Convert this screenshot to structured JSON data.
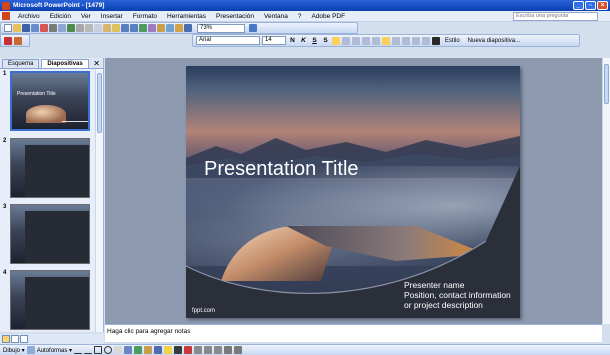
{
  "window": {
    "title": "Microsoft PowerPoint - [1479]"
  },
  "menu": {
    "items": [
      "Archivo",
      "Edición",
      "Ver",
      "Insertar",
      "Formato",
      "Herramientas",
      "Presentación",
      "Ventana",
      "?",
      "Adobe PDF"
    ],
    "help_placeholder": "Escriba una pregunta"
  },
  "toolbar": {
    "zoom": "73%",
    "font": "Arial",
    "font_size": "14",
    "design_label": "Estilo",
    "new_slide_label": "Nueva diapositiva..."
  },
  "panes": {
    "tabs": [
      "Esquema",
      "Diapositivas"
    ],
    "close_glyph": "✕"
  },
  "slides": [
    {
      "number": "1",
      "title": "Presentation Title"
    },
    {
      "number": "2"
    },
    {
      "number": "3"
    },
    {
      "number": "4"
    }
  ],
  "slide": {
    "title": "Presentation Title",
    "presenter_name": "Presenter name",
    "position": "Position, contact information",
    "project": "or project description",
    "footer": "fppt.com"
  },
  "notes": {
    "placeholder": "Haga clic para agregar notas"
  },
  "drawing": {
    "draw_label": "Dibujo ▾",
    "autoshapes_label": "Autoformas ▾"
  },
  "colors": {
    "title_bar": "#0a3fb0",
    "selection": "#3a6fcd"
  }
}
